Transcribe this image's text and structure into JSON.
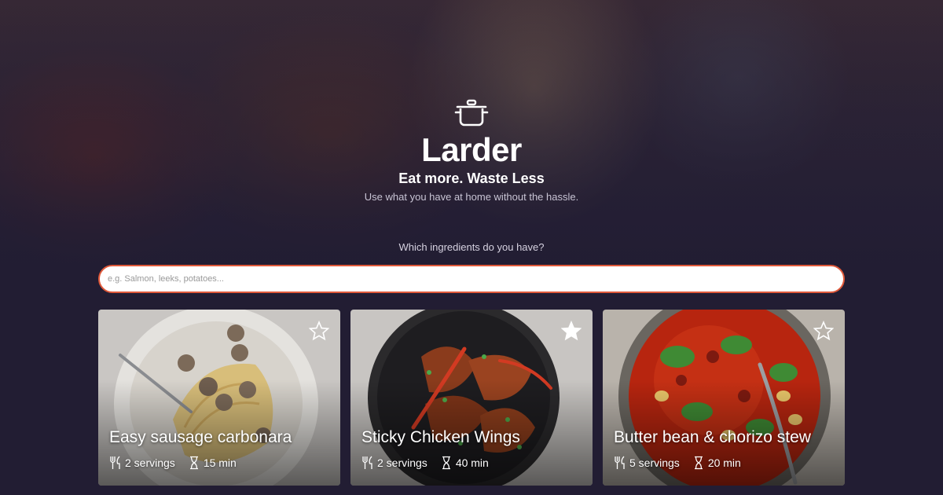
{
  "app": {
    "title": "Larder",
    "tagline": "Eat more. Waste Less",
    "subtitle": "Use what you have at home without the hassle."
  },
  "search": {
    "question": "Which ingredients do you have?",
    "placeholder": "e.g. Salmon, leeks, potatoes...",
    "value": ""
  },
  "icons": {
    "logo": "cooking-pot-icon",
    "servings": "fork-knife-icon",
    "time": "hourglass-icon",
    "favorite": "star-icon"
  },
  "colors": {
    "background": "#221d33",
    "search_border": "#e0593a"
  },
  "recipes": [
    {
      "title": "Easy sausage carbonara",
      "servings": "2 servings",
      "time": "15 min",
      "favorited": false
    },
    {
      "title": "Sticky Chicken Wings",
      "servings": "2 servings",
      "time": "40 min",
      "favorited": true
    },
    {
      "title": "Butter bean & chorizo stew",
      "servings": "5 servings",
      "time": "20 min",
      "favorited": false
    }
  ]
}
